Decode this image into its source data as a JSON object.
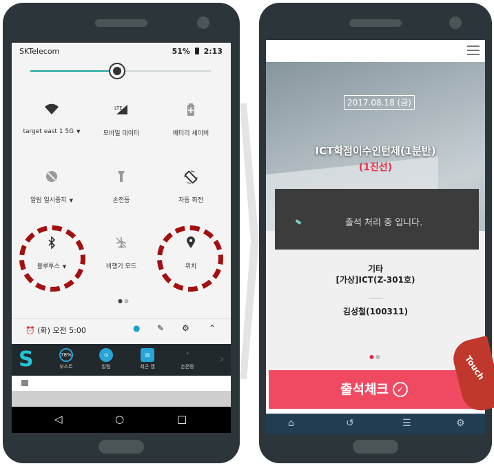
{
  "left_phone": {
    "status_bar": {
      "carrier": "SKTelecom",
      "battery": "51%",
      "time": "2:13"
    },
    "brightness_level": 0.48,
    "tiles": [
      {
        "label": "target east 1 5G",
        "icon": "wifi-icon",
        "caret": "▼",
        "glyph": "▼"
      },
      {
        "label": "모바일 데이터",
        "icon": "mobile-data-icon",
        "glyph": "◢"
      },
      {
        "label": "배터리 세이버",
        "icon": "battery-saver-icon",
        "glyph": "▮"
      },
      {
        "label": "알림 일시중지",
        "icon": "do-not-disturb-icon",
        "caret": "▼",
        "glyph": "⊘"
      },
      {
        "label": "손전등",
        "icon": "flashlight-icon",
        "glyph": "▾"
      },
      {
        "label": "자동 회전",
        "icon": "auto-rotate-icon",
        "glyph": "⟳"
      },
      {
        "label": "블루투스",
        "icon": "bluetooth-icon",
        "caret": "▼",
        "glyph": "ᛒ"
      },
      {
        "label": "비행기 모드",
        "icon": "airplane-mode-icon",
        "glyph": "✈"
      },
      {
        "label": "위치",
        "icon": "location-icon",
        "glyph": "⬤"
      }
    ],
    "quick_settings_bottom": {
      "alarm": "(화) 오전 5:00"
    },
    "dock": [
      {
        "label": "부스트",
        "icon": "boost-icon",
        "badge": "78%"
      },
      {
        "label": "알림",
        "icon": "alarm-clock-icon",
        "badge": ""
      },
      {
        "label": "최근 앱",
        "icon": "recent-apps-icon",
        "badge": ""
      },
      {
        "label": "손전등",
        "icon": "flashlight-icon",
        "badge": ""
      }
    ]
  },
  "right_phone": {
    "date": "2017.08.18 (금)",
    "course_title": "ICT학점이수인턴제(1분반)",
    "course_sub": "(1진선)",
    "toast": "출석 처리 중 입니다.",
    "info": {
      "type": "기타",
      "room": "[가상]ICT(Z-301호)",
      "name": "김성철(100311)"
    },
    "checkin_label": "출석체크",
    "touch_label": "Touch",
    "colors": {
      "accent": "#f04a63",
      "nav": "#223d52",
      "ring": "#a31010"
    }
  }
}
